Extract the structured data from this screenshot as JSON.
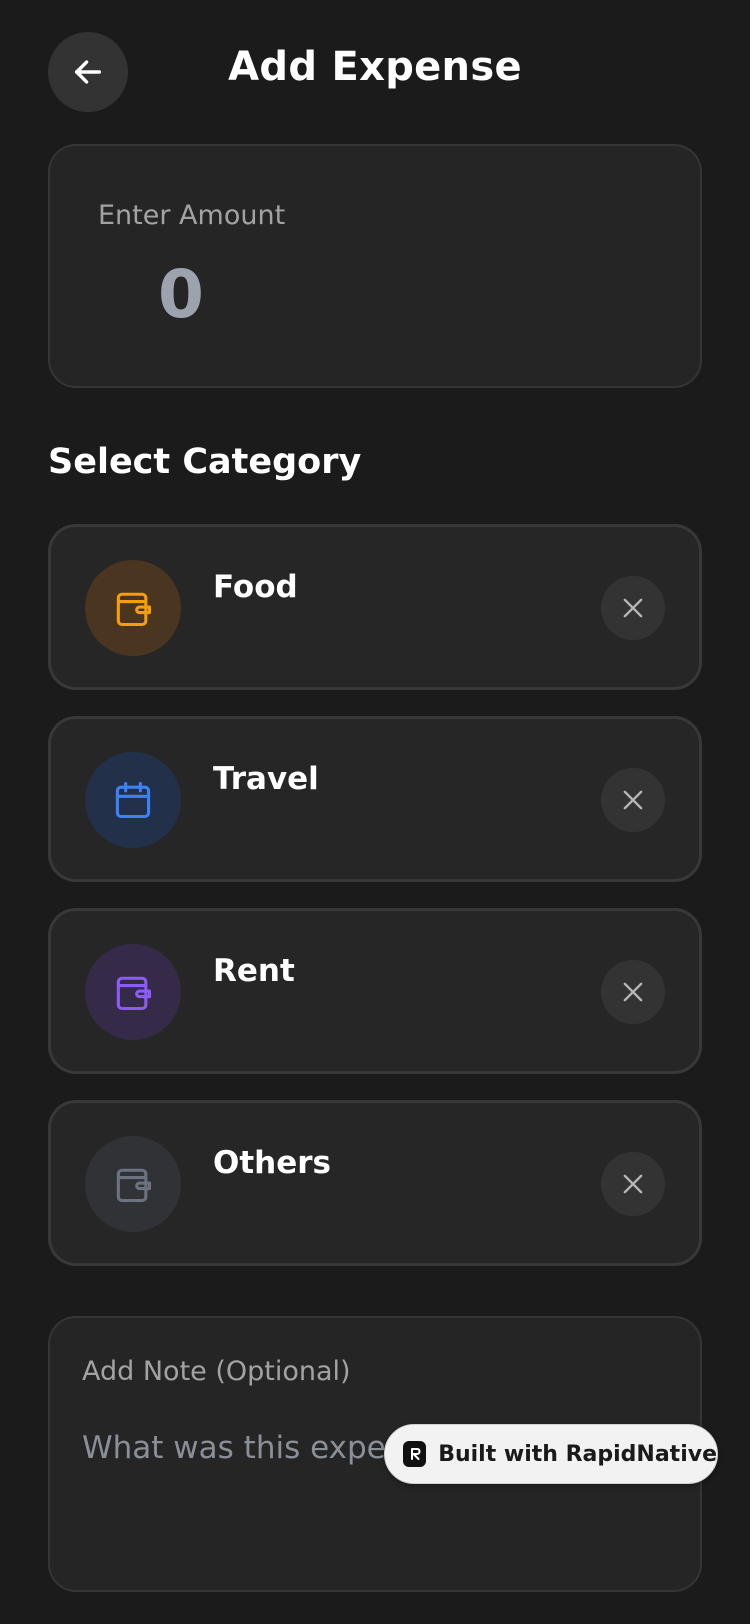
{
  "header": {
    "title": "Add Expense",
    "back_icon": "arrow-left-icon"
  },
  "amount": {
    "label": "Enter Amount",
    "value": "0"
  },
  "category_section": {
    "title": "Select Category"
  },
  "categories": [
    {
      "label": "Food",
      "icon": "wallet-icon",
      "accent": "#f59e0b",
      "bg": "#4a3520"
    },
    {
      "label": "Travel",
      "icon": "calendar-icon",
      "accent": "#3b82f6",
      "bg": "#22304a"
    },
    {
      "label": "Rent",
      "icon": "wallet-icon",
      "accent": "#8b5cf6",
      "bg": "#352a48"
    },
    {
      "label": "Others",
      "icon": "wallet-icon",
      "accent": "#6b7280",
      "bg": "#313235"
    }
  ],
  "note": {
    "label": "Add Note (Optional)",
    "placeholder": "What was this expense for?"
  },
  "badge": {
    "text": "Built with RapidNative"
  }
}
